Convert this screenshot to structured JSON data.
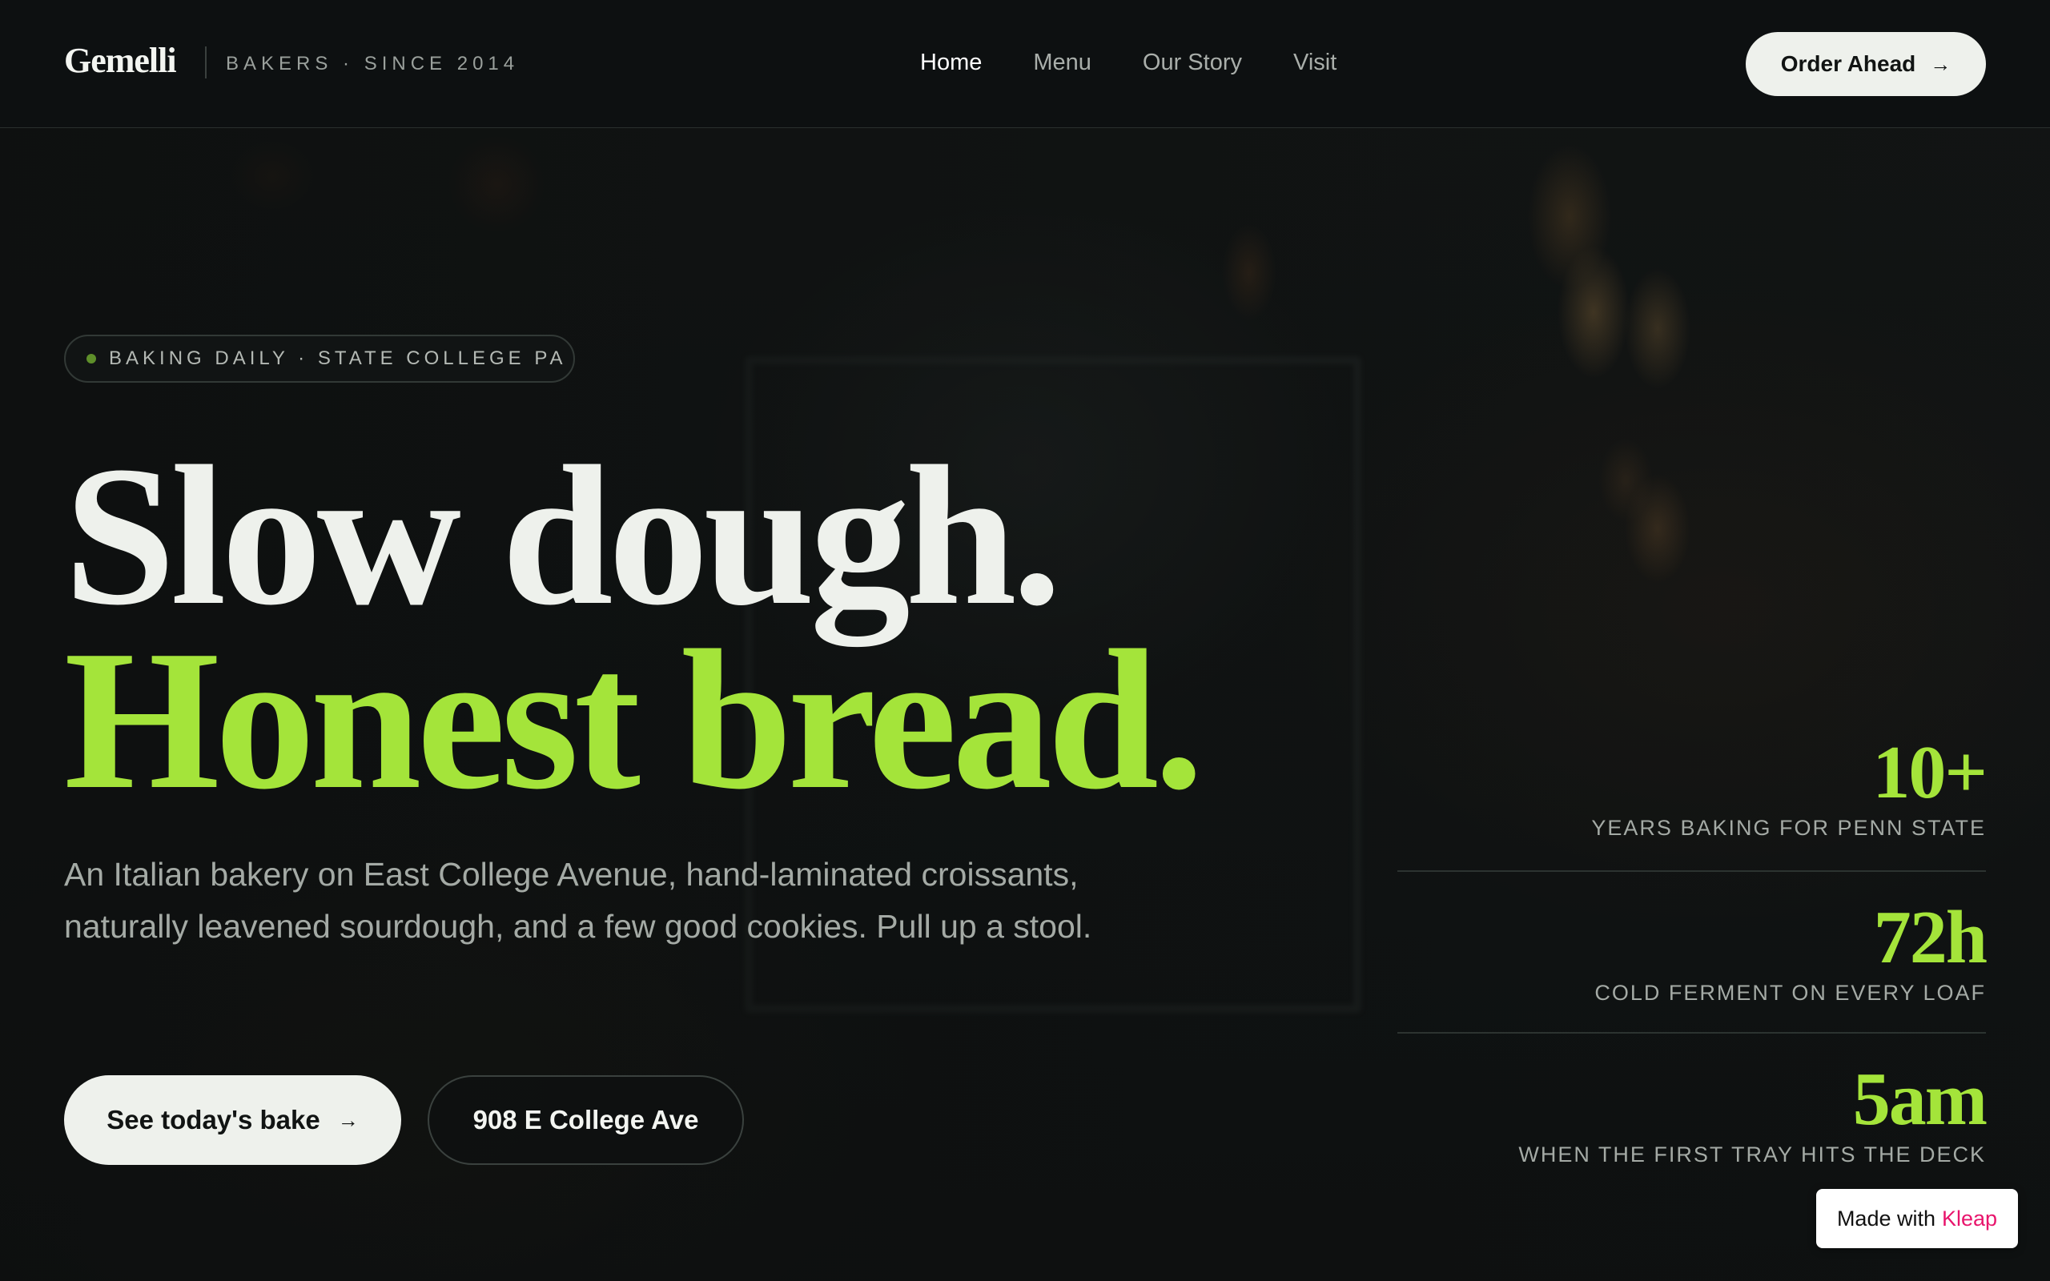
{
  "header": {
    "brand": "Gemelli",
    "tagline": "BAKERS · SINCE 2014",
    "nav": [
      {
        "label": "Home",
        "active": true
      },
      {
        "label": "Menu",
        "active": false
      },
      {
        "label": "Our Story",
        "active": false
      },
      {
        "label": "Visit",
        "active": false
      }
    ],
    "cta_label": "Order Ahead",
    "cta_icon": "arrow-right-icon"
  },
  "hero": {
    "eyebrow": "BAKING DAILY · STATE COLLEGE PA",
    "headline_line1": "Slow dough.",
    "headline_line2": "Honest bread.",
    "lead": "An Italian bakery on East College Avenue, hand-laminated croissants, naturally leavened sourdough, and a few good cookies. Pull up a stool.",
    "primary_button": "See today's bake",
    "secondary_button": "908 E College Ave"
  },
  "stats": [
    {
      "value": "10+",
      "label": "YEARS BAKING FOR PENN STATE"
    },
    {
      "value": "72h",
      "label": "COLD FERMENT ON EVERY LOAF"
    },
    {
      "value": "5am",
      "label": "WHEN THE FIRST TRAY HITS THE DECK"
    }
  ],
  "badge": {
    "prefix": "Made with",
    "brand": "Kleap"
  },
  "colors": {
    "accent": "#a4e43a",
    "background": "#0d1011",
    "text": "#eef1ec",
    "badge_brand": "#e8156c"
  }
}
